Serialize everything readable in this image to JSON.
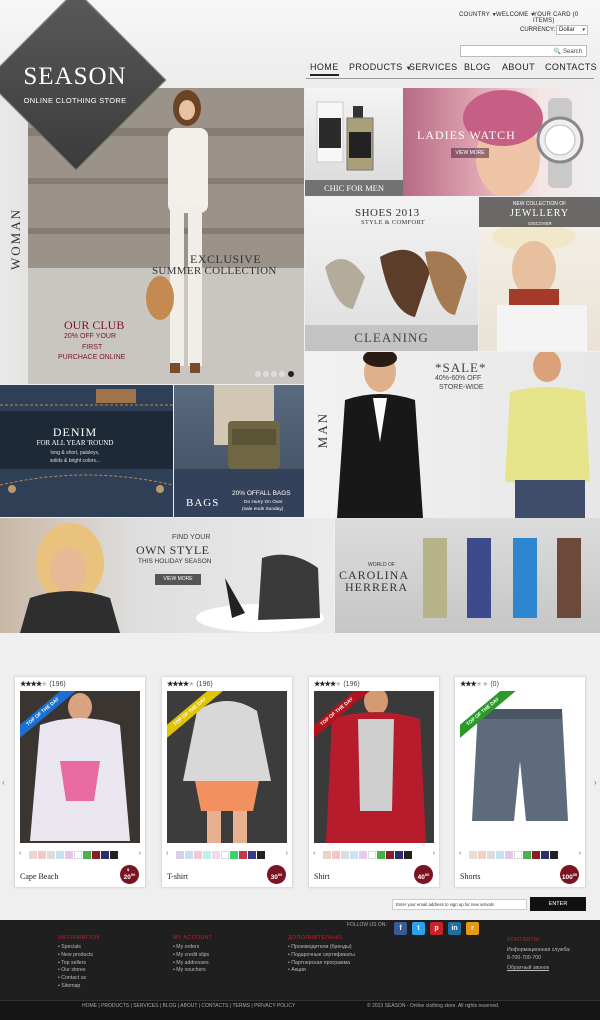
{
  "topbar": {
    "country": "COUNTRY",
    "welcome": "WELCOME",
    "cart": "YOUR CARD (0 ITEMS)",
    "currency_label": "CURRENCY:",
    "currency_value": "Dollar",
    "search_placeholder": "Search"
  },
  "nav": {
    "items": [
      "HOME",
      "PRODUCTS",
      "SERVICES",
      "BLOG",
      "ABOUT",
      "CONTACTS"
    ],
    "active": "HOME"
  },
  "logo": {
    "title": "SEASON",
    "subtitle": "ONLINE CLOTHING STORE"
  },
  "hero": {
    "side_label": "WOMAN",
    "title_line1": "EXCLUSIVE",
    "title_line2": "SUMMER COLLECTION",
    "club_title": "OUR CLUB",
    "club_line1": "20% OFF YOUR",
    "club_line2": "FIRST",
    "club_line3": "PURCHACE ONLINE"
  },
  "tiles": {
    "perfume": "CHIC FOR MEN",
    "watch_title": "LADIES WATCH",
    "watch_btn": "VIEW MORE",
    "shoes_title": "SHOES 2013",
    "shoes_sub": "STYLE & COMFORT",
    "jewel_pre": "NEW COLLECTION OF",
    "jewel_title": "JEWLLERY",
    "jewel_btn": "DISCOVER",
    "cleaning": "CLEANING",
    "man_label": "MAN",
    "sale_title": "*SALE*",
    "sale_line1": "40%-60% OFF",
    "sale_line2": "STORE-WIDE",
    "denim_title": "DENIM",
    "denim_sub": "FOR ALL YEAR 'ROUND",
    "denim_l1": "long & short, paisleys,",
    "denim_l2": "solids & bright colors...",
    "bags_title": "BAGS",
    "bags_off": "20% OFFALL BAGS",
    "bags_l1": "Do Hurry On Over",
    "bags_l2": "(sale ends Sunday)",
    "style_l1": "FIND YOUR",
    "style_l2": "OWN STYLE",
    "style_l3": "THIS HOLIDAY SEASON",
    "style_btn": "VIEW MORE",
    "ch_pre": "WORLD OF",
    "ch_l1": "CAROLINA",
    "ch_l2": "HERRERA"
  },
  "products": [
    {
      "name": "Cape Beach",
      "reviews": "(196)",
      "stars": 4,
      "badge": "TOP OF THE DAY",
      "badge_color": "#1a6fd0",
      "price": "20",
      "cents": "00"
    },
    {
      "name": "T-shirt",
      "reviews": "(196)",
      "stars": 4,
      "badge": "TOP OF THE DAY",
      "badge_color": "#e2c400",
      "price": "30",
      "cents": "00"
    },
    {
      "name": "Shirt",
      "reviews": "(196)",
      "stars": 4,
      "badge": "TOP OF THE DAY",
      "badge_color": "#b0121e",
      "price": "40",
      "cents": "00"
    },
    {
      "name": "Shorts",
      "reviews": "(0)",
      "stars": 3,
      "badge": "TOP OF THE DAY",
      "badge_color": "#2a9a2a",
      "price": "100",
      "cents": "00"
    }
  ],
  "price_symbol": "$",
  "newsletter": {
    "placeholder": "Enter your email address to sign up for new arrivals",
    "button": "ENTER"
  },
  "follow": "FOLLOW US ON:",
  "footer": {
    "col1": {
      "title": "INFORMATION",
      "items": [
        "Specials",
        "New products",
        "Top sellers",
        "Our stores",
        "Contact us",
        "Sitemap"
      ]
    },
    "col2": {
      "title": "MY ACCOUNT",
      "items": [
        "My orders",
        "My credit slips",
        "My addresses",
        "My vouchers"
      ]
    },
    "col3": {
      "title": "ДОПОЛНИТЕЛЬНО",
      "items": [
        "Производители (бренды)",
        "Подарочные сертификаты",
        "Партнерская программа",
        "Акции"
      ]
    },
    "col4": {
      "title": "КОНТАКТЫ",
      "items": [
        "Информационная служба:",
        "8-700-700-700",
        "Обратный звонок"
      ]
    }
  },
  "bottom": {
    "links": "HOME | PRODUCTS | SERVICES | BLOG | ABOUT | CONTACTS | TERMS | PRIVACY POLICY",
    "copyright": "© 2013 SEASON - Online clothing store. All rights reserved."
  },
  "colors": {
    "accent": "#7a1422",
    "footer_bg": "#1f1f1f",
    "footer_head": "#c0202d"
  }
}
